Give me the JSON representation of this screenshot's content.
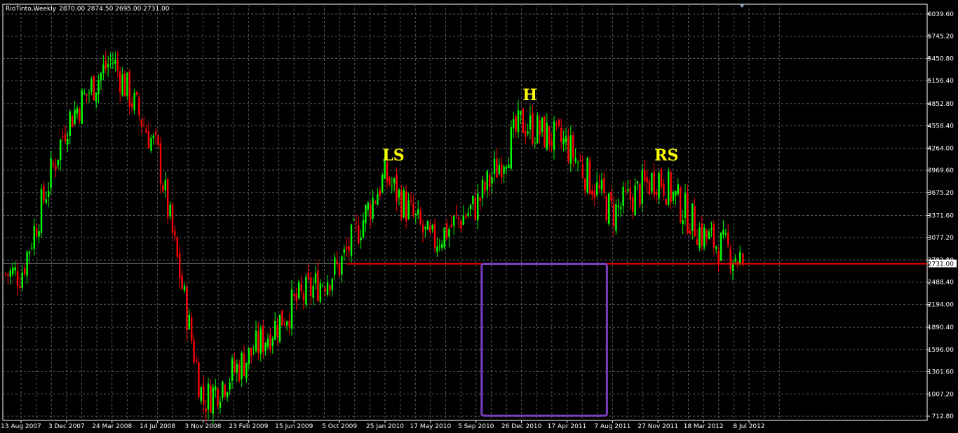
{
  "header": {
    "symbol": "RioTinto,Weekly",
    "ohlc": "2870.00 2874.50 2695.00 2731.00"
  },
  "colors": {
    "background": "#000000",
    "grid": "#5a5a5a",
    "axis": "#ffffff",
    "bull": "#00ff00",
    "bear": "#ff0000",
    "neckline": "#ff0000",
    "box": "#7a3fc0",
    "pattern_label": "#ffff00",
    "current_price_tag": "#ffffff"
  },
  "chart_data": {
    "type": "candlestick",
    "timeframe": "Weekly",
    "ylim": [
      712.8,
      6039.6
    ],
    "y_ticks": [
      "6039.60",
      "5745.20",
      "5450.80",
      "5156.40",
      "4852.80",
      "4558.40",
      "4264.00",
      "3969.60",
      "3675.20",
      "3371.60",
      "3077.20",
      "2782.80",
      "2488.40",
      "2194.00",
      "1890.40",
      "1596.00",
      "1301.60",
      "1007.20",
      "712.80"
    ],
    "x_ticks": [
      "13 Aug 2007",
      "3 Dec 2007",
      "24 Mar 2008",
      "14 Jul 2008",
      "3 Nov 2008",
      "23 Feb 2009",
      "15 Jun 2009",
      "5 Oct 2009",
      "25 Jan 2010",
      "17 May 2010",
      "5 Sep 2010",
      "26 Dec 2010",
      "17 Apr 2011",
      "7 Aug 2011",
      "27 Nov 2011",
      "18 Mar 2012",
      "8 Jul 2012"
    ],
    "current_price": "2731.00",
    "last_bar": {
      "open": 2870.0,
      "high": 2874.5,
      "low": 2695.0,
      "close": 2731.0
    },
    "price_path": [
      [
        "13 Aug 2007",
        2600
      ],
      [
        "3 Dec 2007",
        4600
      ],
      [
        "24 Mar 2008",
        5450
      ],
      [
        "14 Jul 2008",
        4200
      ],
      [
        "3 Nov 2008",
        900
      ],
      [
        "23 Feb 2009",
        1500
      ],
      [
        "15 Jun 2009",
        2200
      ],
      [
        "5 Oct 2009",
        2700
      ],
      [
        "25 Jan 2010",
        3900
      ],
      [
        "17 May 2010",
        3000
      ],
      [
        "5 Sep 2010",
        3500
      ],
      [
        "26 Dec 2010",
        4600
      ],
      [
        "17 Apr 2011",
        4300
      ],
      [
        "7 Aug 2011",
        3400
      ],
      [
        "27 Nov 2011",
        3900
      ],
      [
        "18 Mar 2012",
        3100
      ],
      [
        "8 Jul 2012",
        2731
      ]
    ],
    "annotations": {
      "pattern_labels": [
        {
          "text": "LS",
          "at": "25 Jan 2010",
          "price": 4100
        },
        {
          "text": "H",
          "at": "26 Dec 2010",
          "price": 4900
        },
        {
          "text": "RS",
          "at": "27 Nov 2011",
          "price": 4100
        }
      ],
      "neckline": {
        "price": 2731,
        "from": "5 Oct 2009",
        "to": "8 Jul 2012"
      },
      "box": {
        "from": "5 Sep 2010",
        "to": "7 Aug 2011",
        "top": 2731,
        "bottom": 720
      }
    },
    "grid": true
  }
}
